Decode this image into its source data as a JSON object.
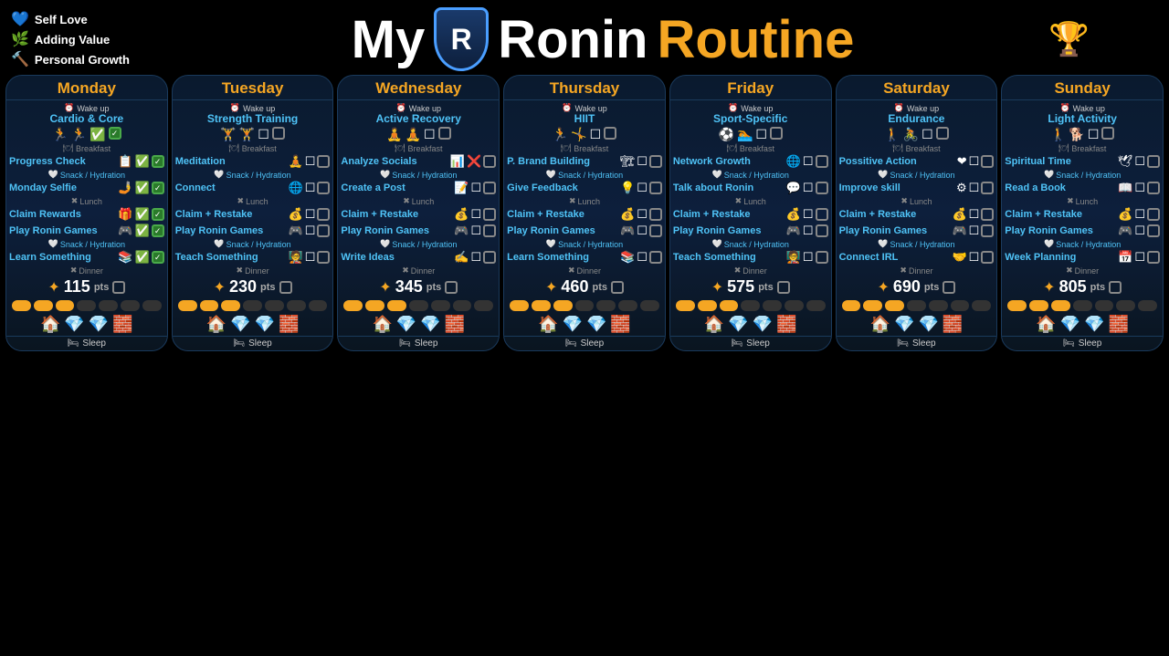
{
  "header": {
    "title_my": "My",
    "title_ronin": "Ronin",
    "title_routine": "Routine",
    "logo_letter": "R",
    "legend": [
      {
        "icon": "💙",
        "label": "Self Love"
      },
      {
        "icon": "🌿",
        "label": "Adding Value"
      },
      {
        "icon": "🔨",
        "label": "Personal Growth"
      }
    ]
  },
  "days": [
    {
      "name": "Monday",
      "wake": "Wake up",
      "activity": "Cardio & Core",
      "activity_icons": [
        "🏃",
        "🏃",
        "✅"
      ],
      "checked": true,
      "tasks": [
        {
          "label": "Breakfast",
          "type": "sep",
          "icon": "🍽"
        },
        {
          "label": "Progress Check",
          "icons": [
            "📋",
            "✅"
          ],
          "checked": true,
          "color": "cyan"
        },
        {
          "label": "Snack / Hydration",
          "type": "snack"
        },
        {
          "label": "Monday Selfie",
          "icons": [
            "🤳",
            "✅"
          ],
          "checked": true,
          "color": "cyan"
        },
        {
          "label": "Lunch",
          "type": "xsep"
        },
        {
          "label": "Claim Rewards",
          "icons": [
            "🎁",
            "✅"
          ],
          "checked": true,
          "color": "cyan"
        },
        {
          "label": "Play Ronin Games",
          "icons": [
            "🎮",
            "✅"
          ],
          "checked": true,
          "color": "cyan"
        },
        {
          "label": "Snack / Hydration",
          "type": "snack"
        },
        {
          "label": "Learn Something",
          "icons": [
            "📚",
            "✅"
          ],
          "checked": true,
          "color": "cyan"
        },
        {
          "label": "Dinner",
          "type": "xsep"
        }
      ],
      "points": "115",
      "progress": [
        1,
        1,
        1,
        0,
        0,
        0,
        0
      ],
      "bottom_icons": [
        "🏠",
        "💎",
        "💎",
        "🧱"
      ]
    },
    {
      "name": "Tuesday",
      "wake": "Wake up",
      "activity": "Strength Training",
      "activity_icons": [
        "🏋",
        "🏋",
        "☐"
      ],
      "checked": false,
      "tasks": [
        {
          "label": "Breakfast",
          "type": "sep",
          "icon": "🍽"
        },
        {
          "label": "Meditation",
          "icons": [
            "🧘",
            "☐"
          ],
          "checked": false,
          "color": "cyan"
        },
        {
          "label": "Snack / Hydration",
          "type": "snack"
        },
        {
          "label": "Connect",
          "icons": [
            "🌐",
            "☐"
          ],
          "checked": false,
          "color": "cyan"
        },
        {
          "label": "Lunch",
          "type": "xsep"
        },
        {
          "label": "Claim + Restake",
          "icons": [
            "💰",
            "☐"
          ],
          "checked": false,
          "color": "cyan"
        },
        {
          "label": "Play Ronin Games",
          "icons": [
            "🎮",
            "☐"
          ],
          "checked": false,
          "color": "cyan"
        },
        {
          "label": "Snack / Hydration",
          "type": "snack"
        },
        {
          "label": "Teach Something",
          "icons": [
            "🧑‍🏫",
            "☐"
          ],
          "checked": false,
          "color": "cyan"
        },
        {
          "label": "Dinner",
          "type": "xsep"
        }
      ],
      "points": "230",
      "progress": [
        1,
        1,
        1,
        0,
        0,
        0,
        0
      ],
      "bottom_icons": [
        "🏠",
        "💎",
        "💎",
        "🧱"
      ]
    },
    {
      "name": "Wednesday",
      "wake": "Wake up",
      "activity": "Active Recovery",
      "activity_icons": [
        "🧘",
        "🧘",
        "☐"
      ],
      "checked": false,
      "tasks": [
        {
          "label": "Breakfast",
          "type": "sep",
          "icon": "🍽"
        },
        {
          "label": "Analyze Socials",
          "icons": [
            "📊",
            "❌"
          ],
          "checked": false,
          "color": "cyan"
        },
        {
          "label": "Snack / Hydration",
          "type": "snack"
        },
        {
          "label": "Create a Post",
          "icons": [
            "📝",
            "☐"
          ],
          "checked": false,
          "color": "cyan"
        },
        {
          "label": "Lunch",
          "type": "xsep"
        },
        {
          "label": "Claim + Restake",
          "icons": [
            "💰",
            "☐"
          ],
          "checked": false,
          "color": "cyan"
        },
        {
          "label": "Play Ronin Games",
          "icons": [
            "🎮",
            "☐"
          ],
          "checked": false,
          "color": "cyan"
        },
        {
          "label": "Snack / Hydration",
          "type": "snack"
        },
        {
          "label": "Write Ideas",
          "icons": [
            "✍",
            "☐"
          ],
          "checked": false,
          "color": "cyan"
        },
        {
          "label": "Dinner",
          "type": "xsep"
        }
      ],
      "points": "345",
      "progress": [
        1,
        1,
        1,
        0,
        0,
        0,
        0
      ],
      "bottom_icons": [
        "🏠",
        "💎",
        "💎",
        "🧱"
      ]
    },
    {
      "name": "Thursday",
      "wake": "Wake up",
      "activity": "HIIT",
      "activity_icons": [
        "🏃",
        "🤸",
        "☐"
      ],
      "checked": false,
      "tasks": [
        {
          "label": "Breakfast",
          "type": "sep",
          "icon": "🍽"
        },
        {
          "label": "P. Brand Building",
          "icons": [
            "🏗",
            "☐"
          ],
          "checked": false,
          "color": "cyan"
        },
        {
          "label": "Snack / Hydration",
          "type": "snack"
        },
        {
          "label": "Give Feedback",
          "icons": [
            "💡",
            "☐"
          ],
          "checked": false,
          "color": "cyan"
        },
        {
          "label": "Lunch",
          "type": "xsep"
        },
        {
          "label": "Claim + Restake",
          "icons": [
            "💰",
            "☐"
          ],
          "checked": false,
          "color": "cyan"
        },
        {
          "label": "Play Ronin Games",
          "icons": [
            "🎮",
            "☐"
          ],
          "checked": false,
          "color": "cyan"
        },
        {
          "label": "Snack / Hydration",
          "type": "snack"
        },
        {
          "label": "Learn Something",
          "icons": [
            "📚",
            "☐"
          ],
          "checked": false,
          "color": "cyan"
        },
        {
          "label": "Dinner",
          "type": "xsep"
        }
      ],
      "points": "460",
      "progress": [
        1,
        1,
        1,
        0,
        0,
        0,
        0
      ],
      "bottom_icons": [
        "🏠",
        "💎",
        "💎",
        "🧱"
      ]
    },
    {
      "name": "Friday",
      "wake": "Wake up",
      "activity": "Sport-Specific",
      "activity_icons": [
        "⚽",
        "🏊",
        "☐"
      ],
      "checked": false,
      "tasks": [
        {
          "label": "Breakfast",
          "type": "sep",
          "icon": "🍽"
        },
        {
          "label": "Network Growth",
          "icons": [
            "🌐",
            "☐"
          ],
          "checked": false,
          "color": "cyan"
        },
        {
          "label": "Snack / Hydration",
          "type": "snack"
        },
        {
          "label": "Talk about Ronin",
          "icons": [
            "💬",
            "☐"
          ],
          "checked": false,
          "color": "cyan"
        },
        {
          "label": "Lunch",
          "type": "xsep"
        },
        {
          "label": "Claim + Restake",
          "icons": [
            "💰",
            "☐"
          ],
          "checked": false,
          "color": "cyan"
        },
        {
          "label": "Play Ronin Games",
          "icons": [
            "🎮",
            "☐"
          ],
          "checked": false,
          "color": "cyan"
        },
        {
          "label": "Snack / Hydration",
          "type": "snack"
        },
        {
          "label": "Teach Something",
          "icons": [
            "🧑‍🏫",
            "☐"
          ],
          "checked": false,
          "color": "cyan"
        },
        {
          "label": "Dinner",
          "type": "xsep"
        }
      ],
      "points": "575",
      "progress": [
        1,
        1,
        1,
        0,
        0,
        0,
        0
      ],
      "bottom_icons": [
        "🏠",
        "💎",
        "💎",
        "🧱"
      ]
    },
    {
      "name": "Saturday",
      "wake": "Wake up",
      "activity": "Endurance",
      "activity_icons": [
        "🚶",
        "🚴",
        "☐"
      ],
      "checked": false,
      "tasks": [
        {
          "label": "Breakfast",
          "type": "sep",
          "icon": "🍽"
        },
        {
          "label": "Possitive Action",
          "icons": [
            "❤",
            "☐"
          ],
          "checked": false,
          "color": "cyan"
        },
        {
          "label": "Snack / Hydration",
          "type": "snack"
        },
        {
          "label": "Improve skill",
          "icons": [
            "⚙",
            "☐"
          ],
          "checked": false,
          "color": "cyan"
        },
        {
          "label": "Lunch",
          "type": "xsep"
        },
        {
          "label": "Claim + Restake",
          "icons": [
            "💰",
            "☐"
          ],
          "checked": false,
          "color": "cyan"
        },
        {
          "label": "Play Ronin Games",
          "icons": [
            "🎮",
            "☐"
          ],
          "checked": false,
          "color": "cyan"
        },
        {
          "label": "Snack / Hydration",
          "type": "snack"
        },
        {
          "label": "Connect IRL",
          "icons": [
            "🤝",
            "☐"
          ],
          "checked": false,
          "color": "cyan"
        },
        {
          "label": "Dinner",
          "type": "xsep"
        }
      ],
      "points": "690",
      "progress": [
        1,
        1,
        1,
        0,
        0,
        0,
        0
      ],
      "bottom_icons": [
        "🏠",
        "💎",
        "💎",
        "🧱"
      ]
    },
    {
      "name": "Sunday",
      "wake": "Wake up",
      "activity": "Light Activity",
      "activity_icons": [
        "🚶",
        "🐕",
        "☐"
      ],
      "checked": false,
      "tasks": [
        {
          "label": "Breakfast",
          "type": "sep",
          "icon": "🍽"
        },
        {
          "label": "Spiritual Time",
          "icons": [
            "🕊",
            "☐"
          ],
          "checked": false,
          "color": "cyan"
        },
        {
          "label": "Snack / Hydration",
          "type": "snack"
        },
        {
          "label": "Read a Book",
          "icons": [
            "📖",
            "☐"
          ],
          "checked": false,
          "color": "cyan"
        },
        {
          "label": "Lunch",
          "type": "xsep"
        },
        {
          "label": "Claim + Restake",
          "icons": [
            "💰",
            "☐"
          ],
          "checked": false,
          "color": "cyan"
        },
        {
          "label": "Play Ronin Games",
          "icons": [
            "🎮",
            "☐"
          ],
          "checked": false,
          "color": "cyan"
        },
        {
          "label": "Snack / Hydration",
          "type": "snack"
        },
        {
          "label": "Week Planning",
          "icons": [
            "📅",
            "☐"
          ],
          "checked": false,
          "color": "cyan"
        },
        {
          "label": "Dinner",
          "type": "xsep"
        }
      ],
      "points": "805",
      "progress": [
        1,
        1,
        1,
        0,
        0,
        0,
        0
      ],
      "bottom_icons": [
        "🏠",
        "💎",
        "💎",
        "🧱"
      ]
    }
  ],
  "sleep_label": "Sleep"
}
